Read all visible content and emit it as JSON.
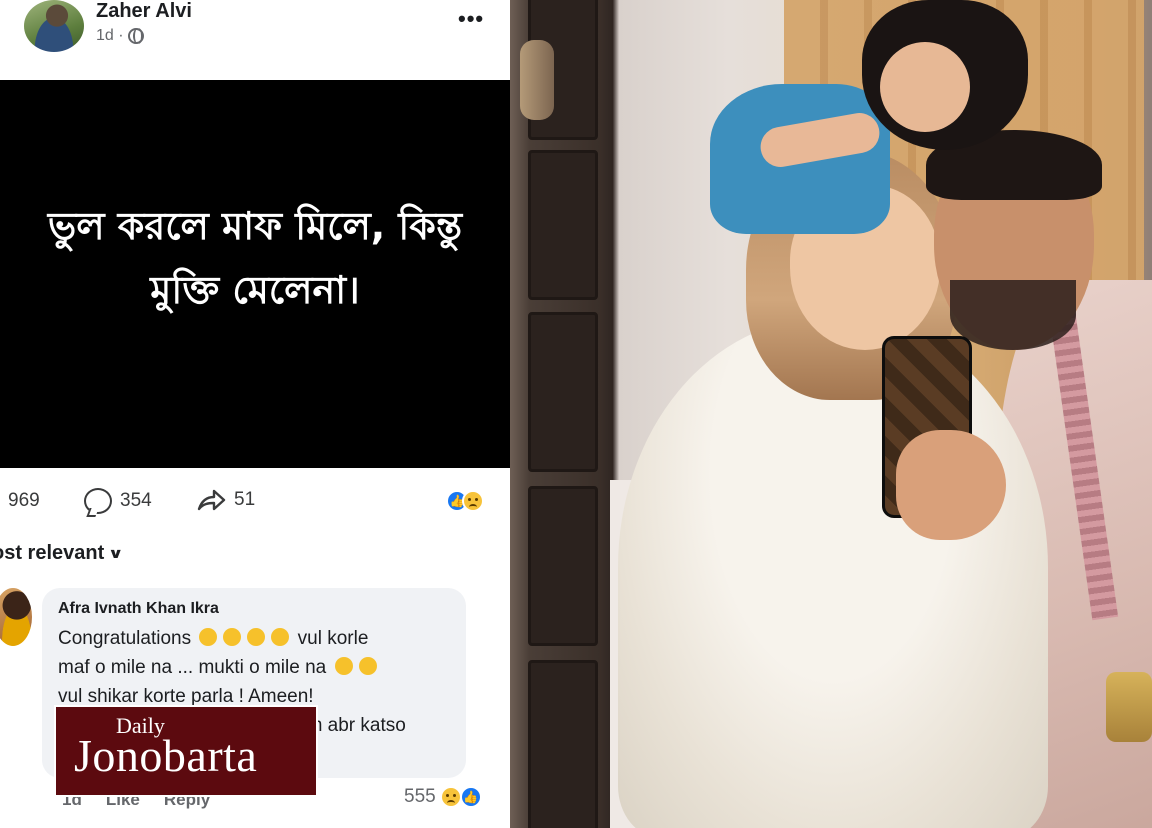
{
  "post": {
    "author": "Zaher Alvi",
    "time": "1d ·",
    "more_label": "•••",
    "status_text_line1": "ভুল করলে মাফ মিলে, কিন্তু",
    "status_text_line2": "মুক্তি মেলেনা।",
    "stats": {
      "reactions": "969",
      "comments": "354",
      "shares": "51"
    },
    "sort_label": "ost relevant"
  },
  "comment": {
    "author": "Afra Ivnath Khan Ikra",
    "line1": "Congratulations",
    "line1_tail": "vul korle",
    "line2": "maf o mile na ... mukti o mile na",
    "line3": "vul shikar korte parla ! Ameen!",
    "line4_tail": "am abr katso",
    "time": "1d",
    "like_label": "Like",
    "reply_label": "Reply",
    "reaction_count": "555"
  },
  "brand": {
    "small": "Daily",
    "big": "Jonobarta"
  },
  "colors": {
    "brand_bg": "#5c0a0f",
    "like_blue": "#1877f2",
    "status_bg": "#000000"
  }
}
